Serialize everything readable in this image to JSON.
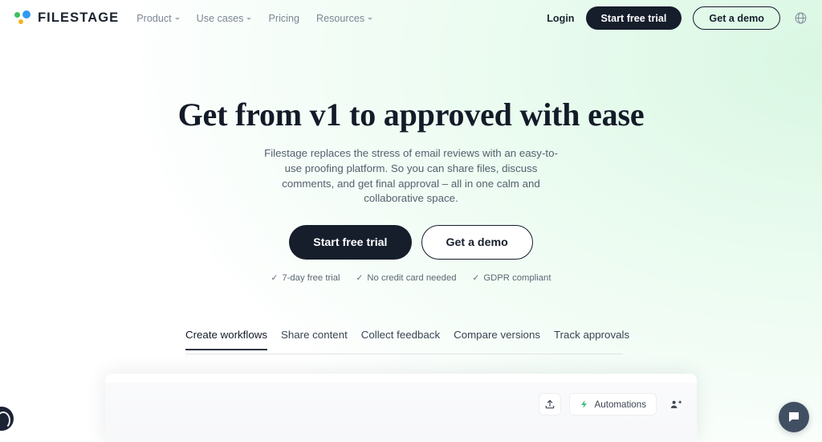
{
  "header": {
    "brand": {
      "name": "FILESTAGE",
      "dot_green": "#3fbf5f",
      "dot_blue": "#2f9cf0",
      "dot_yellow": "#f5b324"
    },
    "nav": [
      {
        "label": "Product",
        "has_caret": true
      },
      {
        "label": "Use cases",
        "has_caret": true
      },
      {
        "label": "Pricing",
        "has_caret": false
      },
      {
        "label": "Resources",
        "has_caret": true
      }
    ],
    "login_label": "Login",
    "start_trial_label": "Start free trial",
    "get_demo_label": "Get a demo",
    "language_icon": "globe-icon"
  },
  "hero": {
    "headline": "Get from v1 to approved with ease",
    "subhead": "Filestage replaces the stress of email reviews with an easy-to-use proofing platform. So you can share files, discuss comments, and get final approval – all in one calm and collaborative space.",
    "primary_cta": "Start free trial",
    "secondary_cta": "Get a demo",
    "perks": [
      {
        "tick": "✓",
        "label": "7-day free trial"
      },
      {
        "tick": "✓",
        "label": "No credit card needed"
      },
      {
        "tick": "✓",
        "label": "GDPR compliant"
      }
    ]
  },
  "tabs": {
    "active_index": 0,
    "items": [
      {
        "label": "Create workflows"
      },
      {
        "label": "Share content"
      },
      {
        "label": "Collect feedback"
      },
      {
        "label": "Compare versions"
      },
      {
        "label": "Track approvals"
      }
    ]
  },
  "app_preview": {
    "upload_icon": "upload-icon",
    "automations_label": "Automations",
    "automations_icon": "lightning-bolt-icon",
    "invite_icon": "add-person-icon"
  },
  "widgets": {
    "cookie_icon": "cookie-consent-icon",
    "chat_icon": "chat-bubble-icon"
  },
  "colors": {
    "dark": "#161d2b",
    "mint": "#e6faee",
    "muted": "#7b8694",
    "chat_bubble": "#414f63"
  }
}
